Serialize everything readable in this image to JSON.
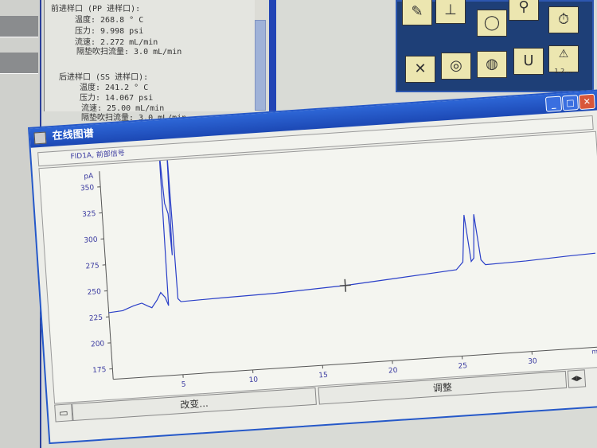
{
  "info_panel": {
    "front_inlet": {
      "header": "前进样口 (PP 进样口):",
      "temp": "温度:  268.8 ° C",
      "pressure": "压力:  9.998 psi",
      "flow": "流速:  2.272 mL/min",
      "purge": "隔垫吹扫流量:  3.0 mL/min"
    },
    "back_inlet": {
      "header": "后进样口 (SS 进样口):",
      "temp": "温度:  241.2 ° C",
      "pressure": "压力:  14.067 psi",
      "flow": "流速:  25.00 mL/min",
      "purge": "隔垫吹扫流量:  3.0 mL/min"
    }
  },
  "toolbar": {
    "icons": [
      "syringe-icon",
      "valve-icon",
      "column-icon",
      "magnifier-icon",
      "stopwatch-icon",
      "tools-icon",
      "circle-icon",
      "gauge-icon",
      "recycle-icon",
      "warning-icon"
    ],
    "warning_label": "1.2...."
  },
  "window": {
    "title": "在线图谱",
    "signal": "FID1A, 前部信号",
    "change_button": "改变...",
    "adjust_button": "调整"
  },
  "chart_data": {
    "type": "line",
    "title": "FID1A, 前部信号",
    "ylabel": "pA",
    "xlabel": "min",
    "xlim": [
      0,
      35
    ],
    "ylim": [
      165,
      365
    ],
    "xticks": [
      5,
      10,
      15,
      20,
      25,
      30
    ],
    "yticks": [
      175,
      200,
      225,
      250,
      275,
      300,
      325,
      350
    ],
    "color": "#2a3fc8",
    "series": [
      {
        "name": "FID1A",
        "x": [
          0,
          1,
          1.8,
          2.4,
          2.8,
          3.1,
          3.5,
          3.8,
          4.1,
          4.3,
          4.35,
          4.5,
          4.7,
          4.8,
          4.9,
          5.0,
          5.2,
          8,
          12,
          17,
          20,
          23,
          25,
          25.5,
          25.8,
          26.1,
          26.3,
          26.5,
          26.8,
          27.1,
          30,
          33,
          35
        ],
        "y": [
          229,
          230,
          234,
          236,
          233,
          231,
          238,
          245,
          240,
          232,
          420,
          330,
          320,
          280,
          420,
          238,
          235,
          236,
          237,
          240,
          243,
          246,
          248,
          255,
          300,
          255,
          258,
          300,
          256,
          251,
          252,
          254,
          255
        ]
      }
    ],
    "crosshair": {
      "x": 17,
      "y": 240
    }
  }
}
